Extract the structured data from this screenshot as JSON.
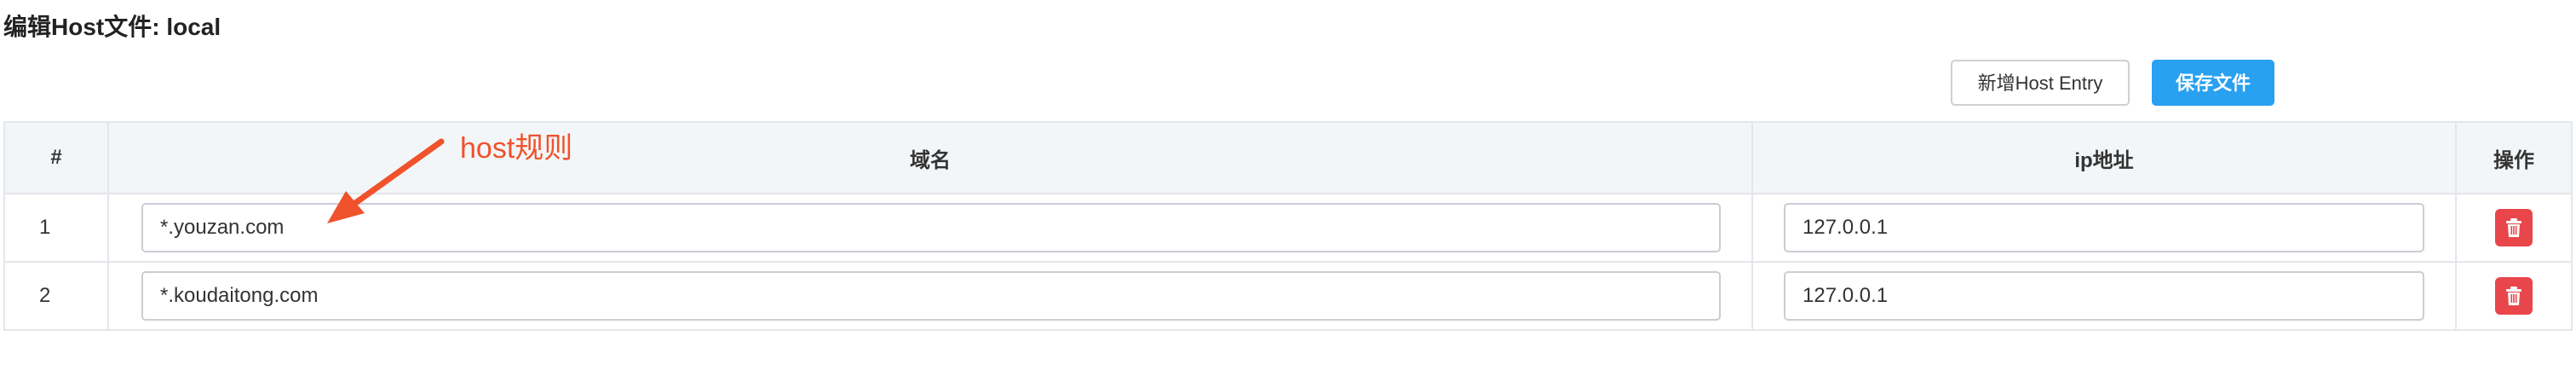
{
  "page": {
    "title": "编辑Host文件: local"
  },
  "toolbar": {
    "add_label": "新增Host Entry",
    "save_label": "保存文件"
  },
  "table": {
    "columns": [
      "#",
      "域名",
      "ip地址",
      "操作"
    ],
    "rows": [
      {
        "index": "1",
        "domain": "*.youzan.com",
        "ip": "127.0.0.1"
      },
      {
        "index": "2",
        "domain": "*.koudaitong.com",
        "ip": "127.0.0.1"
      }
    ]
  },
  "annotation": {
    "label": "host规则",
    "color": "#f0522c"
  },
  "icons": {
    "delete": "trash-icon"
  },
  "colors": {
    "primary": "#29a0f0",
    "danger": "#e8464b"
  }
}
